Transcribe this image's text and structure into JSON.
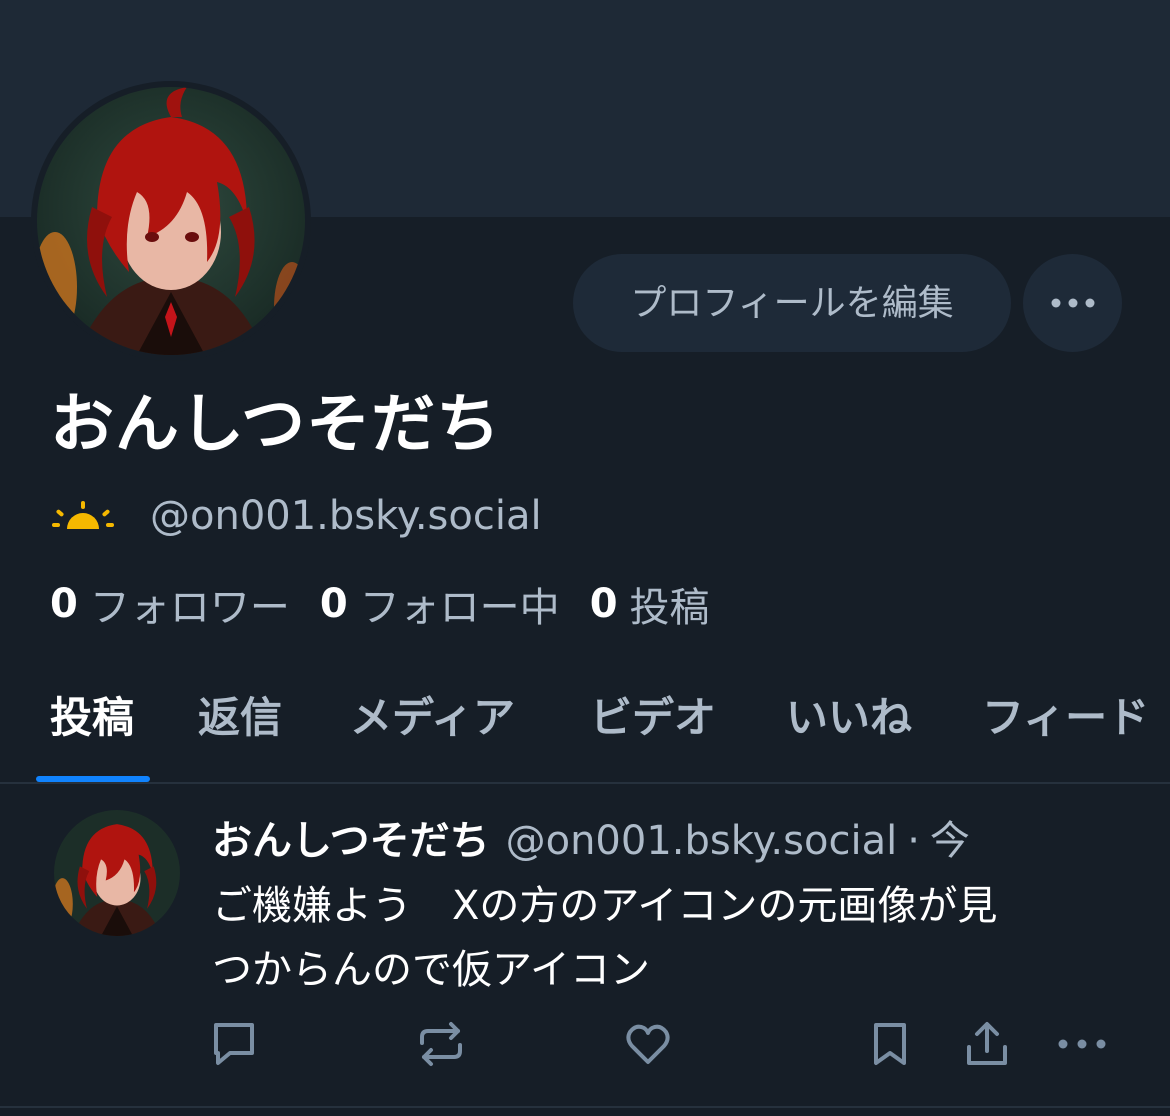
{
  "profile": {
    "edit_button": "プロフィールを編集",
    "display_name": "おんしつそだち",
    "handle": "@on001.bsky.social",
    "badge_icon": "sun-icon",
    "accent": "#f5b800"
  },
  "stats": {
    "followers_count": "0",
    "followers_label": "フォロワー",
    "following_count": "0",
    "following_label": "フォロー中",
    "posts_count": "0",
    "posts_label": "投稿"
  },
  "tabs": [
    {
      "label": "投稿",
      "active": true
    },
    {
      "label": "返信"
    },
    {
      "label": "メディア"
    },
    {
      "label": "ビデオ"
    },
    {
      "label": "いいね"
    },
    {
      "label": "フィード"
    }
  ],
  "post": {
    "author": "おんしつそだち",
    "handle": "@on001.bsky.social",
    "separator": "·",
    "time": "今",
    "text": "ご機嫌よう　Xの方のアイコンの元画像が見\nつからんので仮アイコン",
    "actions": [
      "reply-icon",
      "repost-icon",
      "like-icon",
      "bookmark-icon",
      "share-icon",
      "more-icon"
    ]
  },
  "colors": {
    "background": "#161e27",
    "banner": "#1e2936",
    "tab_underline": "#1083fe",
    "muted_text": "#aebbc9"
  }
}
